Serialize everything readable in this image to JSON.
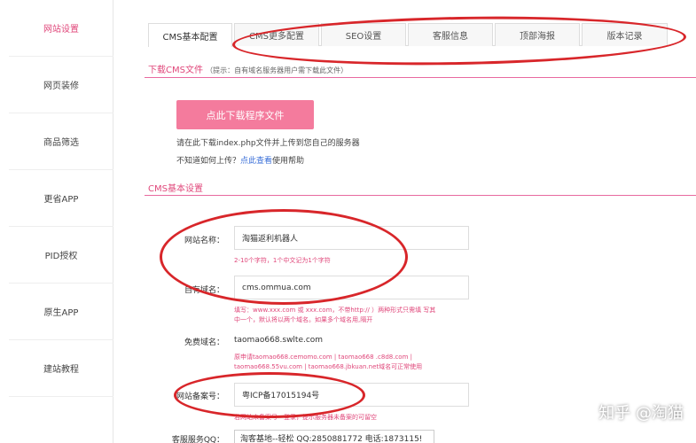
{
  "sidebar": {
    "items": [
      {
        "label": "网站设置"
      },
      {
        "label": "网页装修"
      },
      {
        "label": "商品筛选"
      },
      {
        "label": "更省APP"
      },
      {
        "label": "PID授权"
      },
      {
        "label": "原生APP"
      },
      {
        "label": "建站教程"
      }
    ]
  },
  "tabs": [
    {
      "label": "CMS基本配置"
    },
    {
      "label": "CMS更多配置"
    },
    {
      "label": "SEO设置"
    },
    {
      "label": "客服信息"
    },
    {
      "label": "顶部海报"
    },
    {
      "label": "版本记录"
    }
  ],
  "download_section": {
    "title": "下载CMS文件",
    "hint": "（提示：自有域名服务器用户需下载此文件）",
    "button_label": "点此下载程序文件",
    "instruction": "请在此下载index.php文件并上传到您自己的服务器",
    "help_prefix": "不知道如何上传？",
    "help_link": "点此查看",
    "help_suffix": "使用帮助"
  },
  "basic_section": {
    "title": "CMS基本设置",
    "site_name_label": "网站名称：",
    "site_name_value": "淘猫返利机器人",
    "site_name_hint": "2-10个字符，1个中文记为1个字符",
    "domain_label": "自有域名：",
    "domain_value": "cms.ommua.com",
    "domain_hint_1": "填写：www.xxx.com 或 xxx.com，不带http:// ）两种形式只需填 写其",
    "domain_hint_2": "中一个，默认将以两个域名。如果多个域名用,隔开",
    "free_domain_label": "免费域名：",
    "free_domain_value": "taomao668.swlte.com",
    "free_domain_hint_1": "原申请taomao668.cemomo.com | taomao668 .c8d8.com |",
    "free_domain_hint_2": "taomao668.55vu.com | taomao668.jbkuan.net域名可正常使用",
    "icp_label": "网站备案号：",
    "icp_value": "粤ICP备17015194号",
    "icp_hint": "若网站未备案号一登录，提示服务器未备案的可留空",
    "qq_label": "客服服务QQ：",
    "qq_value": "淘客基地--轻松 QQ:2850881772 电话:1873115!"
  },
  "watermark": "知乎 @淘猫",
  "colors": {
    "accent": "#e0487b",
    "button": "#f47b9d",
    "annotation": "#d8262a"
  }
}
